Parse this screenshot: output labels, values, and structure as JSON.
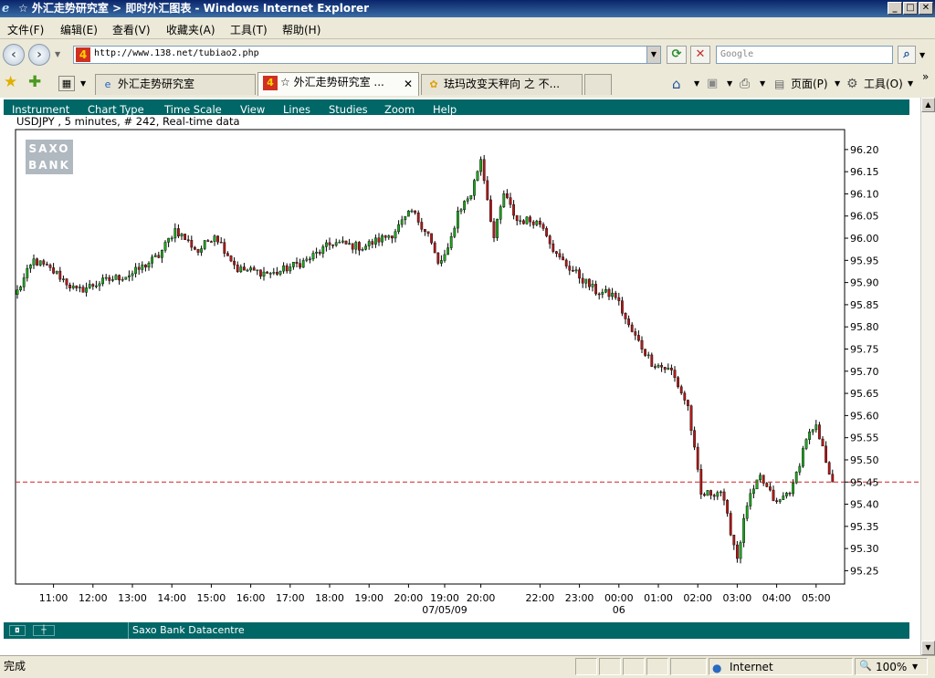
{
  "window": {
    "title": "☆ 外汇走势研究室 > 即时外汇图表 - Windows Internet Explorer",
    "btn_min": "_",
    "btn_max": "□",
    "btn_close": "✕"
  },
  "menu": [
    "文件(F)",
    "编辑(E)",
    "查看(V)",
    "收藏夹(A)",
    "工具(T)",
    "帮助(H)"
  ],
  "address": {
    "url": "http://www.138.net/tubiao2.php",
    "search_placeholder": "Google"
  },
  "tabs": [
    {
      "label": "外汇走势研究室"
    },
    {
      "label": "☆ 外汇走势研究室 ..."
    },
    {
      "label": "珐玛改变天秤向 之 不..."
    }
  ],
  "toolbar": {
    "page": "页面(P)",
    "tools": "工具(O)",
    "more": "»"
  },
  "applet": {
    "menu": [
      "Instrument",
      "Chart Type",
      "Time Scale",
      "View",
      "Lines",
      "Studies",
      "Zoom",
      "Help"
    ],
    "info": "USDJPY , 5 minutes, # 242, Real-time data",
    "logo_text": [
      "SAXO",
      "BANK"
    ],
    "footer": "Saxo Bank Datacentre"
  },
  "status": {
    "left": "完成",
    "zone": "Internet",
    "zoom": "100%"
  },
  "colors": {
    "up": "#1fa31f",
    "down": "#b01818",
    "accent": "#006666",
    "ref_line": "#d02020"
  },
  "chart_data": {
    "type": "candlestick",
    "title": "USDJPY , 5 minutes, # 242, Real-time data",
    "x_ticks": [
      "11:00",
      "12:00",
      "13:00",
      "14:00",
      "15:00",
      "16:00",
      "17:00",
      "18:00",
      "19:00",
      "20:00",
      "19:00",
      "20:00",
      "22:00",
      "23:00",
      "00:00",
      "01:00",
      "02:00",
      "03:00",
      "04:00",
      "05:00"
    ],
    "x_tick_candle_index": [
      11,
      23,
      35,
      47,
      59,
      71,
      83,
      95,
      107,
      119,
      130,
      141,
      159,
      171,
      183,
      195,
      207,
      219,
      231,
      243
    ],
    "date_labels": [
      {
        "text": "07/05/09",
        "index": 130
      },
      {
        "text": "06",
        "index": 183
      }
    ],
    "y_ticks": [
      "96.20",
      "96.15",
      "96.10",
      "96.05",
      "96.00",
      "95.95",
      "95.90",
      "95.85",
      "95.80",
      "95.75",
      "95.70",
      "95.65",
      "95.60",
      "95.55",
      "95.50",
      "95.45",
      "95.40",
      "95.35",
      "95.30",
      "95.25"
    ],
    "ylim": [
      95.22,
      96.245
    ],
    "reference_line": 95.45,
    "last_price": 95.45,
    "anchors": [
      [
        0,
        95.88
      ],
      [
        5,
        95.95
      ],
      [
        12,
        95.92
      ],
      [
        18,
        95.88
      ],
      [
        25,
        95.9
      ],
      [
        35,
        95.92
      ],
      [
        43,
        95.96
      ],
      [
        48,
        96.02
      ],
      [
        55,
        95.97
      ],
      [
        60,
        96.01
      ],
      [
        67,
        95.93
      ],
      [
        78,
        95.92
      ],
      [
        88,
        95.95
      ],
      [
        96,
        95.99
      ],
      [
        105,
        95.98
      ],
      [
        114,
        96.01
      ],
      [
        120,
        96.06
      ],
      [
        125,
        96.01
      ],
      [
        128,
        95.94
      ],
      [
        131,
        95.97
      ],
      [
        134,
        96.06
      ],
      [
        138,
        96.1
      ],
      [
        141,
        96.18
      ],
      [
        145,
        96.0
      ],
      [
        148,
        96.1
      ],
      [
        152,
        96.04
      ],
      [
        157,
        96.04
      ],
      [
        160,
        96.03
      ],
      [
        164,
        95.96
      ],
      [
        170,
        95.92
      ],
      [
        176,
        95.88
      ],
      [
        182,
        95.87
      ],
      [
        186,
        95.8
      ],
      [
        193,
        95.72
      ],
      [
        199,
        95.7
      ],
      [
        204,
        95.62
      ],
      [
        208,
        95.42
      ],
      [
        214,
        95.43
      ],
      [
        219,
        95.28
      ],
      [
        222,
        95.4
      ],
      [
        226,
        95.46
      ],
      [
        231,
        95.4
      ],
      [
        236,
        95.44
      ],
      [
        240,
        95.55
      ],
      [
        243,
        95.57
      ],
      [
        246,
        95.5
      ],
      [
        248,
        95.45
      ]
    ]
  }
}
